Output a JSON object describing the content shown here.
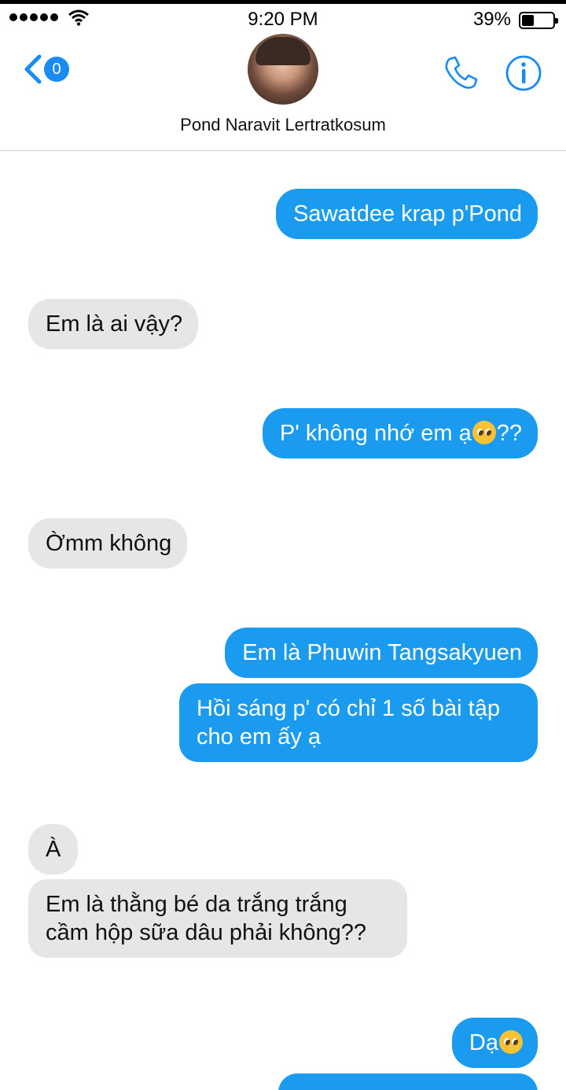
{
  "status_bar": {
    "time": "9:20 PM",
    "battery_percent": "39%",
    "battery_level": 0.39,
    "signal_bars": 5
  },
  "header": {
    "back_badge_count": "0",
    "contact_name": "Pond Naravit Lertratkosum",
    "icons": [
      "back-chevron-icon",
      "phone-icon",
      "info-icon"
    ]
  },
  "colors": {
    "accent": "#1a8af5",
    "outgoing_bubble": "#1a9bf0",
    "incoming_bubble": "#e6e6e9"
  },
  "messages": [
    {
      "direction": "outgoing",
      "text": "Sawatdee krap p'Pond"
    },
    {
      "direction": "incoming",
      "text": "Em là ai vậy?"
    },
    {
      "direction": "outgoing",
      "text": "P' không nhớ em ạ",
      "suffix": "??",
      "emoji": "pleading-face"
    },
    {
      "direction": "incoming",
      "text": "Ờmm không"
    },
    {
      "direction": "outgoing",
      "text": "Em là Phuwin Tangsakyuen"
    },
    {
      "direction": "outgoing",
      "line1": "Hồi sáng p' có chỉ 1 số bài tập",
      "line2": "cho em ấy ạ"
    },
    {
      "direction": "incoming",
      "text": "À"
    },
    {
      "direction": "incoming",
      "line1": "Em là thằng bé da trắng trắng",
      "line2": "cầm hộp sữa dâu phải không??"
    },
    {
      "direction": "outgoing",
      "text": "Dạ",
      "emoji": "pleading-face"
    }
  ]
}
